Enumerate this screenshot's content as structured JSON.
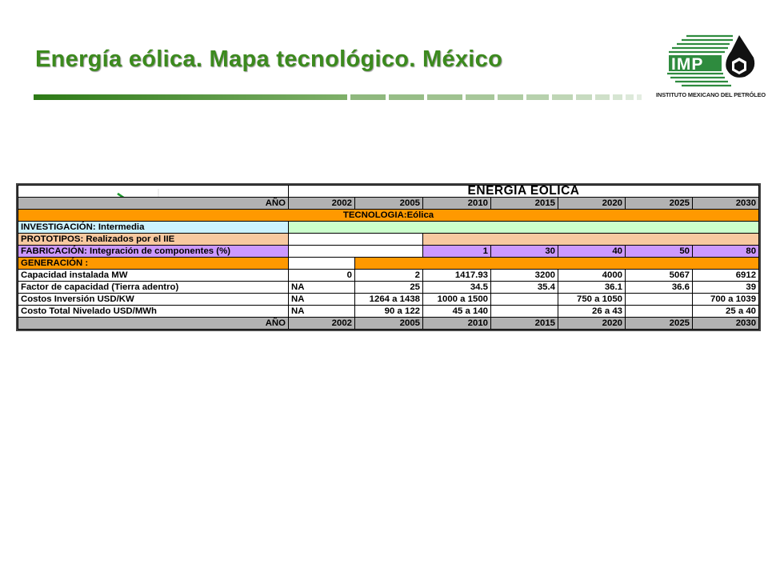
{
  "slide": {
    "title": "Energía eólica. Mapa tecnológico. México"
  },
  "logo": {
    "letters": "IMP",
    "caption": "INSTITUTO MEXICANO DEL PETRÓLEO",
    "colors": {
      "green": "#2e8b3e",
      "black": "#111111"
    }
  },
  "table": {
    "header_title": "ENERGIA EÓLICA",
    "year_label": "AÑO",
    "years": [
      "2002",
      "2005",
      "2010",
      "2015",
      "2020",
      "2025",
      "2030"
    ],
    "technology": "TECNOLOGIA:Eólica",
    "research": "INVESTIGACIÓN: Intermedia",
    "prototypes": "PROTOTIPOS: Realizados por el IIE",
    "fabrication": {
      "label": "FABRICACIÓN: Integración de componentes (%)",
      "values": [
        "",
        "",
        "1",
        "30",
        "40",
        "50",
        "80"
      ]
    },
    "generation": "GENERACIÓN :",
    "rows": [
      {
        "label": "Capacidad instalada MW",
        "values": [
          "0",
          "2",
          "1417.93",
          "3200",
          "4000",
          "5067",
          "6912"
        ]
      },
      {
        "label": "Factor de capacidad (Tierra adentro)",
        "values": [
          "NA",
          "25",
          "34.5",
          "35.4",
          "36.1",
          "36.6",
          "39"
        ]
      },
      {
        "label": "Costos Inversión USD/KW",
        "values": [
          "NA",
          "1264 a 1438",
          "1000 a 1500",
          "",
          "750 a 1050",
          "",
          "700 a 1039"
        ]
      },
      {
        "label": "Costo Total Nivelado USD/MWh",
        "values": [
          "NA",
          "90 a 122",
          "45 a 140",
          "",
          "26 a 43",
          "",
          "25 a 40"
        ]
      }
    ],
    "colors": {
      "gray": "#b2b2b2",
      "orange": "#ff9900",
      "lightblue": "#ccf2ff",
      "lightgreen": "#ccffcc",
      "peach": "#f8c9a0",
      "violet": "#cc99ff"
    }
  }
}
